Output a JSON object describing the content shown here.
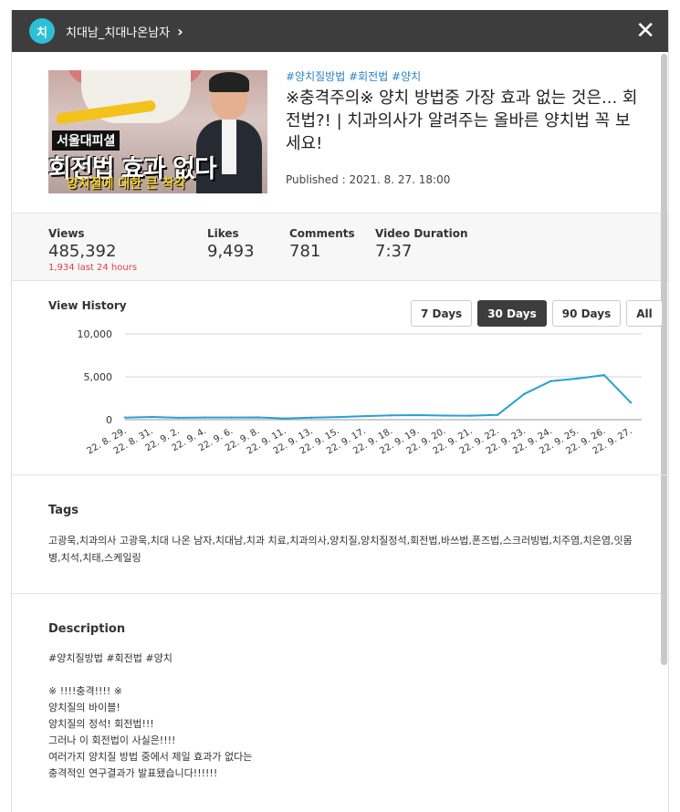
{
  "header": {
    "logo_text": "치",
    "channel_name": "치대남_치대나온남자",
    "chevron": "›",
    "close": "✕"
  },
  "video": {
    "thumbnail": {
      "tag": "서울대피셜",
      "headline": "회전법 효과 없다",
      "subline": "양치질에 대한 큰 착각"
    },
    "hashtags": "#양치질방법 #회전법 #양치",
    "title": "※충격주의※ 양치 방법중 가장 효과 없는 것은... 회전법?! | 치과의사가 알려주는 올바른 양치법 꼭 보세요!",
    "published": "Published : 2021. 8. 27. 18:00"
  },
  "stats": {
    "views": {
      "label": "Views",
      "value": "485,392",
      "delta": "1,934 last 24 hours"
    },
    "likes": {
      "label": "Likes",
      "value": "9,493"
    },
    "comments": {
      "label": "Comments",
      "value": "781"
    },
    "duration": {
      "label": "Video Duration",
      "value": "7:37"
    }
  },
  "view_history": {
    "label": "View History",
    "ranges": [
      "7 Days",
      "30 Days",
      "90 Days",
      "All"
    ],
    "active_range": "30 Days"
  },
  "chart_data": {
    "type": "line",
    "x": [
      "22. 8. 29.",
      "22. 8. 31.",
      "22. 9. 2.",
      "22. 9. 4.",
      "22. 9. 6.",
      "22. 9. 8.",
      "22. 9. 11.",
      "22. 9. 13.",
      "22. 9. 15.",
      "22. 9. 17.",
      "22. 9. 18.",
      "22. 9. 19.",
      "22. 9. 20.",
      "22. 9. 21.",
      "22. 9. 22.",
      "22. 9. 23.",
      "22. 9. 24.",
      "22. 9. 25.",
      "22. 9. 26.",
      "22. 9. 27."
    ],
    "series": [
      {
        "values": [
          250,
          320,
          220,
          260,
          260,
          270,
          150,
          230,
          310,
          420,
          500,
          530,
          480,
          470,
          560,
          3000,
          4500,
          4800,
          5200,
          2000
        ]
      }
    ],
    "yticks": [
      "10,000",
      "5,000",
      "0"
    ],
    "ylim": [
      0,
      10000
    ],
    "grid": true,
    "line_color": "#2a9fd6"
  },
  "tags": {
    "title": "Tags",
    "text": "고광욱,치과의사 고광욱,치대 나온 남자,치대남,치과 치료,치과의사,양치질,양치질정석,회전법,바쓰법,폰즈법,스크러빙법,치주염,치은염,잇몸병,치석,치태,스케일링"
  },
  "description": {
    "title": "Description",
    "lines": [
      "#양치질방법 #회전법 #양치",
      "",
      "※ !!!!충격!!!! ※",
      "양치질의 바이블!",
      "양치질의 정석! 회전법!!!",
      "그러나 이 회전법이 사실은!!!!",
      "여러가지 양치질 방법 중에서 제일 효과가 없다는",
      "충격적인 연구결과가 발표됐습니다!!!!!!"
    ]
  }
}
